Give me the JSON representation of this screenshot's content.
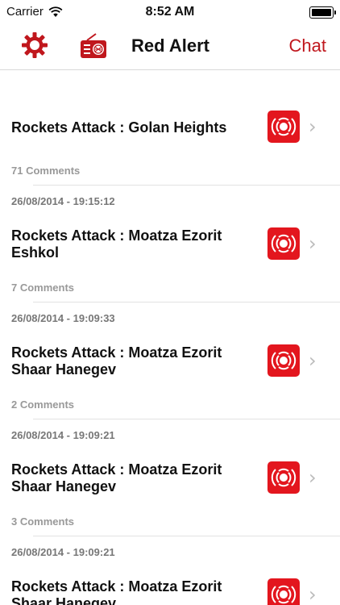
{
  "status_bar": {
    "carrier": "Carrier",
    "time": "8:52 AM"
  },
  "nav": {
    "title": "Red Alert",
    "chat_label": "Chat",
    "settings_icon": "gear-icon",
    "radio_icon": "radio-icon"
  },
  "colors": {
    "accent": "#c0171d",
    "alert_icon_bg": "#e3161e"
  },
  "alerts": [
    {
      "date": "",
      "title": "Rockets Attack : Golan Heights",
      "comments": "71 Comments"
    },
    {
      "date": "26/08/2014 - 19:15:12",
      "title": "Rockets Attack : Moatza Ezorit Eshkol",
      "comments": "7 Comments"
    },
    {
      "date": "26/08/2014 - 19:09:33",
      "title": "Rockets Attack : Moatza Ezorit Shaar Hanegev",
      "comments": "2 Comments"
    },
    {
      "date": "26/08/2014 - 19:09:21",
      "title": "Rockets Attack : Moatza Ezorit Shaar Hanegev",
      "comments": "3 Comments"
    },
    {
      "date": "26/08/2014 - 19:09:21",
      "title": "Rockets Attack : Moatza Ezorit Shaar Hanegev",
      "comments": ""
    }
  ]
}
